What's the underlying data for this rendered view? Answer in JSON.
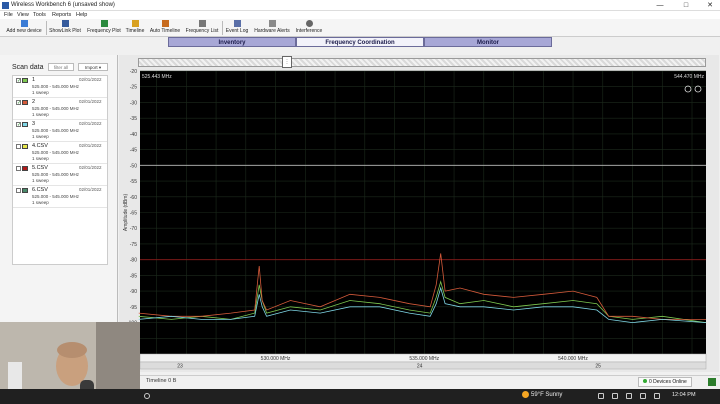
{
  "window": {
    "title": "Wireless Workbench 6 (unsaved show)",
    "controls": [
      "—",
      "□",
      "✕"
    ]
  },
  "menu": [
    "File",
    "View",
    "Tools",
    "Reports",
    "Help"
  ],
  "toolbar": [
    {
      "label": "Add new device",
      "icon": "add-device-icon"
    },
    {
      "label": "ShowLink Plot",
      "icon": "showlink-icon"
    },
    {
      "label": "Frequency Plot",
      "icon": "frequency-plot-icon"
    },
    {
      "label": "Timeline",
      "icon": "timeline-icon"
    },
    {
      "label": "Auto Timeline",
      "icon": "auto-timeline-icon"
    },
    {
      "label": "Frequency List",
      "icon": "frequency-list-icon"
    },
    {
      "label": "Event Log",
      "icon": "event-log-icon"
    },
    {
      "label": "Hardware Alerts",
      "icon": "hardware-alerts-icon"
    },
    {
      "label": "Interference",
      "icon": "interference-icon"
    }
  ],
  "tabs": [
    {
      "label": "Inventory",
      "active": false
    },
    {
      "label": "Frequency Coordination",
      "active": true
    },
    {
      "label": "Monitor",
      "active": false
    }
  ],
  "scan_panel": {
    "title": "Scan data",
    "filter_label": "filter all",
    "import_label": "Import",
    "items": [
      {
        "name": "1",
        "date": "02/01/2022",
        "range": "525.000 - 545.000 MHz",
        "sweeps": "1 sweep",
        "color": "#7ec850",
        "checked": true
      },
      {
        "name": "2",
        "date": "02/01/2022",
        "range": "525.000 - 545.000 MHz",
        "sweeps": "1 sweep",
        "color": "#d45a3a",
        "checked": true
      },
      {
        "name": "3",
        "date": "02/01/2022",
        "range": "525.000 - 545.000 MHz",
        "sweeps": "1 sweep",
        "color": "#7fd6e6",
        "checked": true
      },
      {
        "name": "4.CSV",
        "date": "02/01/2022",
        "range": "525.000 - 545.000 MHz",
        "sweeps": "1 sweep",
        "color": "#e6e64a",
        "checked": false
      },
      {
        "name": "5.CSV",
        "date": "02/01/2022",
        "range": "525.000 - 545.000 MHz",
        "sweeps": "1 sweep",
        "color": "#b01a1a",
        "checked": false
      },
      {
        "name": "6.CSV",
        "date": "02/01/2022",
        "range": "525.000 - 545.000 MHz",
        "sweeps": "1 sweep",
        "color": "#4a8a6a",
        "checked": false
      }
    ]
  },
  "chart_data": {
    "type": "line",
    "ylabel": "Amplitude (dBm)",
    "xrange": [
      525.443,
      544.47
    ],
    "xrange_labels": {
      "start": "525.443 MHz",
      "end": "544.470 MHz"
    },
    "ylim": [
      -110,
      -20
    ],
    "yticks": [
      -20,
      -25,
      -30,
      -35,
      -40,
      -45,
      -50,
      -55,
      -60,
      -65,
      -70,
      -75,
      -80,
      -85,
      -90,
      -95,
      -100,
      -105
    ],
    "xticks": [
      {
        "value": 530.0,
        "label": "530.000 MHz"
      },
      {
        "value": 535.0,
        "label": "535.000 MHz"
      },
      {
        "value": 540.0,
        "label": "540.000 MHz"
      }
    ],
    "channels": [
      {
        "value": 525.443,
        "label": "23"
      },
      {
        "value": 533.5,
        "label": "24"
      },
      {
        "value": 539.5,
        "label": "25"
      }
    ],
    "threshold_lines": [
      {
        "value": -50,
        "color": "#bbbbbb"
      },
      {
        "value": -80,
        "color": "#8a1a1a"
      }
    ],
    "grid": true,
    "background": "#000000",
    "series": [
      {
        "color": "#7ec850",
        "x": [
          525.4,
          526.5,
          527.5,
          528.5,
          529.3,
          529.45,
          529.55,
          529.7,
          530.5,
          531.5,
          532.5,
          533.5,
          534.5,
          535.2,
          535.4,
          535.55,
          535.7,
          536.2,
          537,
          538,
          539,
          540,
          540.8,
          541.2,
          542,
          543,
          544.47
        ],
        "y": [
          -98,
          -99,
          -98,
          -99,
          -97,
          -88,
          -93,
          -97,
          -95,
          -96,
          -93,
          -94,
          -96,
          -97,
          -92,
          -87,
          -92,
          -94,
          -93,
          -95,
          -94,
          -93,
          -94,
          -98,
          -99,
          -98,
          -100
        ]
      },
      {
        "color": "#d45a3a",
        "x": [
          525.4,
          526.5,
          527.5,
          528.5,
          529.3,
          529.45,
          529.55,
          529.7,
          530.5,
          531.5,
          532.5,
          533.5,
          534.5,
          535.2,
          535.4,
          535.55,
          535.7,
          536.2,
          537,
          538,
          539,
          540,
          540.8,
          541.2,
          542,
          543,
          544.47
        ],
        "y": [
          -97,
          -98,
          -98,
          -97,
          -96,
          -82,
          -93,
          -96,
          -93,
          -95,
          -91,
          -92,
          -94,
          -95,
          -88,
          -78,
          -90,
          -89,
          -91,
          -92,
          -91,
          -90,
          -92,
          -98,
          -98,
          -99,
          -99
        ]
      },
      {
        "color": "#7fd6e6",
        "x": [
          525.4,
          526.5,
          527.5,
          528.5,
          529.3,
          529.45,
          529.55,
          529.7,
          530.5,
          531.5,
          532.5,
          533.5,
          534.5,
          535.2,
          535.4,
          535.55,
          535.7,
          536.2,
          537,
          538,
          539,
          540,
          540.8,
          541.2,
          542,
          543,
          544.47
        ],
        "y": [
          -99,
          -98,
          -99,
          -99,
          -98,
          -91,
          -95,
          -98,
          -96,
          -97,
          -95,
          -95,
          -97,
          -98,
          -94,
          -89,
          -94,
          -95,
          -95,
          -96,
          -95,
          -95,
          -96,
          -99,
          -100,
          -99,
          -100
        ]
      }
    ]
  },
  "statusbar": {
    "timeline_label": "Timeline  0 B",
    "devices_online": "0 Devices Online"
  },
  "taskbar": {
    "weather": "59°F  Sunny",
    "time": "12:04 PM"
  }
}
